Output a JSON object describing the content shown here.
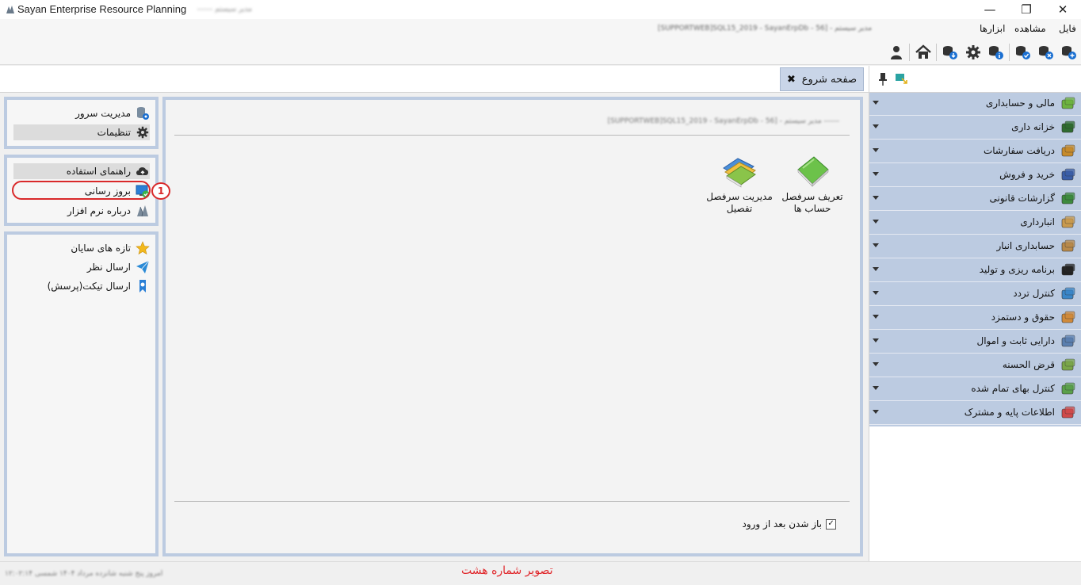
{
  "window": {
    "title": "Sayan Enterprise Resource Planning",
    "user_blurred": "مدیر سیستم ------",
    "controls": {
      "close": "✕",
      "maximize": "❐",
      "minimize": "—"
    }
  },
  "menu": {
    "items": [
      "فایل",
      "مشاهده",
      "ابزارها"
    ],
    "connection_blurred": "[SUPPORTWEB]SQL15_2019 - SayanErpDb - 56] - مدیر سیستم"
  },
  "toolbar": {
    "icons": [
      "user-icon",
      "home-icon",
      "db-download-icon",
      "gear-icon",
      "db-info-icon",
      "db-check-icon",
      "db-remove-icon",
      "db-add-icon"
    ]
  },
  "tab": {
    "label": "صفحه شروع",
    "close_glyph": "✖"
  },
  "start_page": {
    "server_blurred": "[SUPPORTWEB]SQL15_2019 - SayanErpDb - 56] - مدیر سیستم ------",
    "shortcuts": [
      {
        "label_line1": "تعریف سرفصل",
        "label_line2": "حساب ها",
        "icon": "green-book-icon"
      },
      {
        "label_line1": "مدیریت سرفصل",
        "label_line2": "تفصیل",
        "icon": "books-stack-icon"
      }
    ],
    "open_after_login": {
      "label": "باز شدن بعد از ورود",
      "checked": true,
      "check_glyph": "✓"
    }
  },
  "left_panels": {
    "admin": [
      {
        "label": "مدیریت سرور",
        "icon": "server-icon"
      },
      {
        "label": "تنظیمات",
        "icon": "settings-icon"
      }
    ],
    "help": [
      {
        "label": "راهنمای استفاده",
        "icon": "cloud-help-icon"
      },
      {
        "label": "بروز رسانی",
        "icon": "update-icon"
      },
      {
        "label": "درباره نرم افزار",
        "icon": "about-logo-icon"
      }
    ],
    "news": [
      {
        "label": "تازه های سایان",
        "icon": "star-icon"
      },
      {
        "label": "ارسال نظر",
        "icon": "paper-plane-icon"
      },
      {
        "label": "ارسال تیکت(پرسش)",
        "icon": "ticket-icon"
      }
    ],
    "callout_number": "1"
  },
  "modules": [
    {
      "label": "مالی و حسابداری",
      "icon": "finance-icon",
      "color": "#6db33f"
    },
    {
      "label": "خزانه داری",
      "icon": "treasury-icon",
      "color": "#2f6b2f"
    },
    {
      "label": "دریافت سفارشات",
      "icon": "orders-icon",
      "color": "#c78b2b"
    },
    {
      "label": "خرید و فروش",
      "icon": "handshake-icon",
      "color": "#3a5ea8"
    },
    {
      "label": "گزارشات قانونی",
      "icon": "chip-icon",
      "color": "#3d8a3d"
    },
    {
      "label": "انبارداری",
      "icon": "box-icon",
      "color": "#c99a4e"
    },
    {
      "label": "حسابداری انبار",
      "icon": "boxes-icon",
      "color": "#b8894a"
    },
    {
      "label": "برنامه ریزی و تولید",
      "icon": "gears-icon",
      "color": "#222222"
    },
    {
      "label": "کنترل تردد",
      "icon": "clock-icon",
      "color": "#3a86c8"
    },
    {
      "label": "حقوق و دستمزد",
      "icon": "payroll-icon",
      "color": "#d08a3a"
    },
    {
      "label": "دارایی ثابت و اموال",
      "icon": "building-icon",
      "color": "#5a7fb0"
    },
    {
      "label": "قرض الحسنه",
      "icon": "money-icon",
      "color": "#7aa64a"
    },
    {
      "label": "کنترل بهای تمام شده",
      "icon": "cost-icon",
      "color": "#5aa04a"
    },
    {
      "label": "اطلاعات پایه و مشترک",
      "icon": "tools-icon",
      "color": "#d04a4a"
    }
  ],
  "statusbar": {
    "date_blurred": "امروز پنج شنبه شانزده مرداد ۱۴۰۴ شمسی ۱۲:۰۲:۱۴",
    "caption": "تصویر شماره هشت"
  }
}
